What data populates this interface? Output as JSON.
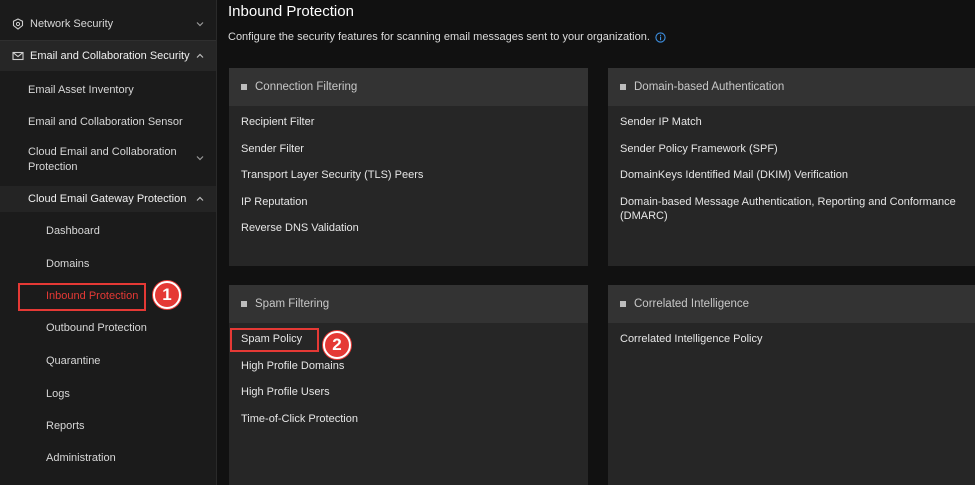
{
  "sidebar": {
    "top_items": [
      {
        "label": "Network Security",
        "icon": "shield-icon",
        "chevron": "down"
      },
      {
        "label": "Email and Collaboration Security",
        "icon": "mail-icon",
        "chevron": "up"
      }
    ],
    "items": [
      {
        "label": "Email Asset Inventory"
      },
      {
        "label": "Email and Collaboration Sensor"
      },
      {
        "label": "Cloud Email and Collaboration Protection",
        "chevron": "down"
      },
      {
        "label": "Cloud Email Gateway Protection",
        "chevron": "up"
      }
    ],
    "subitems": [
      {
        "label": "Dashboard"
      },
      {
        "label": "Domains"
      },
      {
        "label": "Inbound Protection",
        "active": true
      },
      {
        "label": "Outbound Protection"
      },
      {
        "label": "Quarantine"
      },
      {
        "label": "Logs"
      },
      {
        "label": "Reports"
      },
      {
        "label": "Administration"
      }
    ]
  },
  "main": {
    "title": "Inbound Protection",
    "description": "Configure the security features for scanning email messages sent to your organization.",
    "cards": [
      {
        "title": "Connection Filtering",
        "links": [
          "Recipient Filter",
          "Sender Filter",
          "Transport Layer Security (TLS) Peers",
          "IP Reputation",
          "Reverse DNS Validation"
        ]
      },
      {
        "title": "Domain-based Authentication",
        "links": [
          "Sender IP Match",
          "Sender Policy Framework (SPF)",
          "DomainKeys Identified Mail (DKIM) Verification",
          "Domain-based Message Authentication, Reporting and Conformance (DMARC)"
        ]
      },
      {
        "title": "Spam Filtering",
        "links": [
          "Spam Policy",
          "High Profile Domains",
          "High Profile Users",
          "Time-of-Click Protection"
        ]
      },
      {
        "title": "Correlated Intelligence",
        "links": [
          "Correlated Intelligence Policy"
        ]
      }
    ]
  },
  "annotations": {
    "step1": "1",
    "step2": "2"
  },
  "colors": {
    "highlight": "#e53935",
    "sidebar_bg": "#1b1b1b",
    "active_text": "#e53935",
    "card_bg": "#262626",
    "card_header_bg": "#333333",
    "info_icon": "#3d8fe0"
  }
}
